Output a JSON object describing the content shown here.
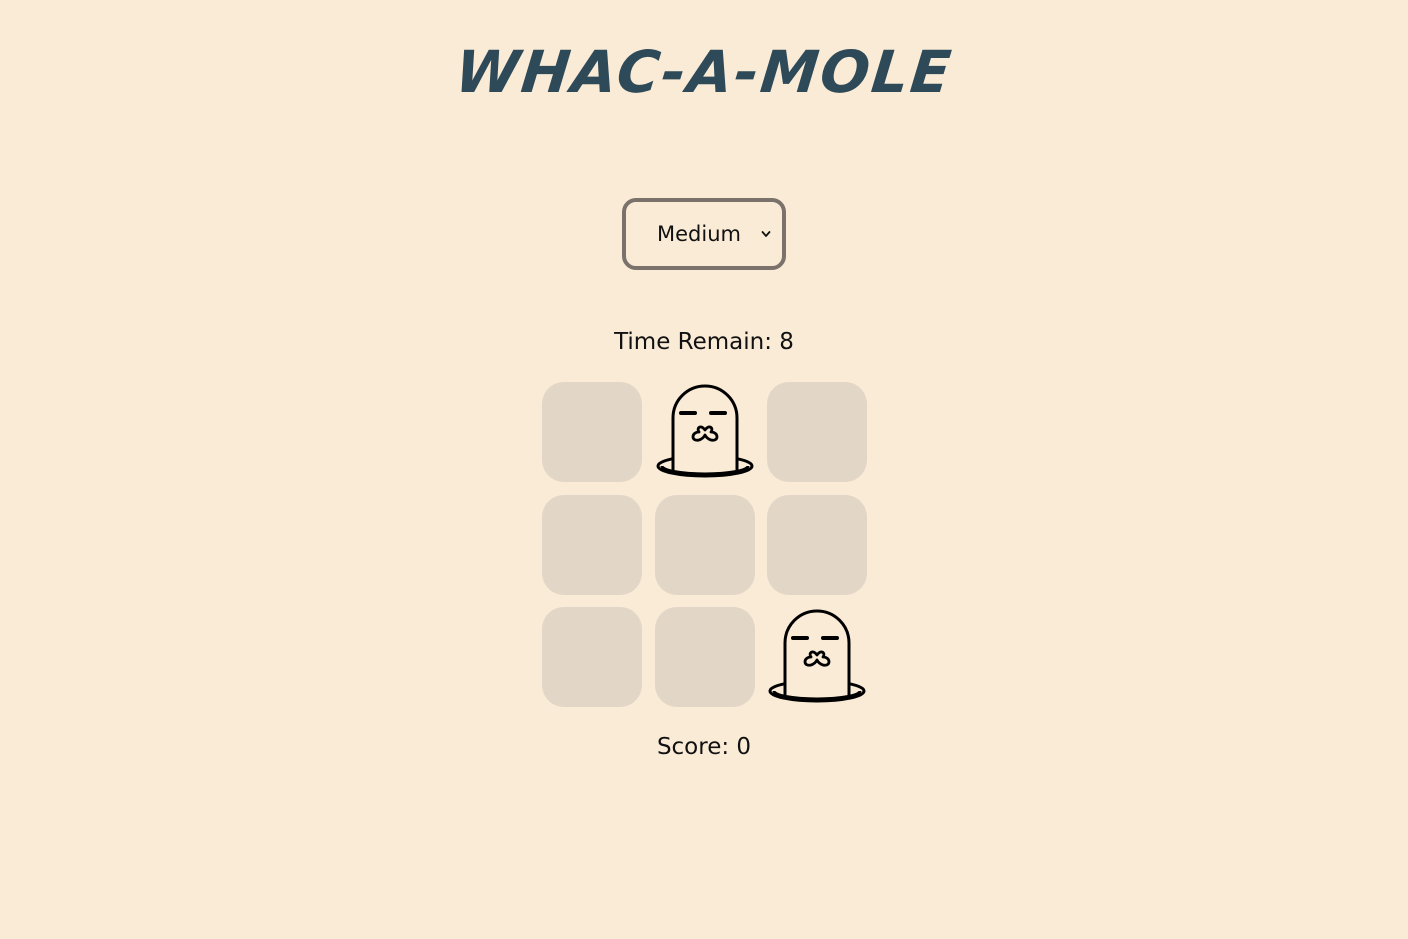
{
  "title": "WHAC-A-MOLE",
  "difficulty": {
    "selected": "Medium"
  },
  "status": {
    "time_label": "Time Remain: 8",
    "score_label": "Score: 0"
  },
  "board": {
    "rows": 3,
    "cols": 3,
    "holes": [
      {
        "mole": false
      },
      {
        "mole": true
      },
      {
        "mole": false
      },
      {
        "mole": false
      },
      {
        "mole": false
      },
      {
        "mole": false
      },
      {
        "mole": false
      },
      {
        "mole": false
      },
      {
        "mole": true
      }
    ]
  },
  "colors": {
    "background": "#faebd7",
    "title": "#2e4a58",
    "hole": "#e2d6c6",
    "select_border": "#7b736b"
  },
  "icons": {
    "mole": "mole-icon",
    "dropdown": "chevron-down-icon"
  }
}
